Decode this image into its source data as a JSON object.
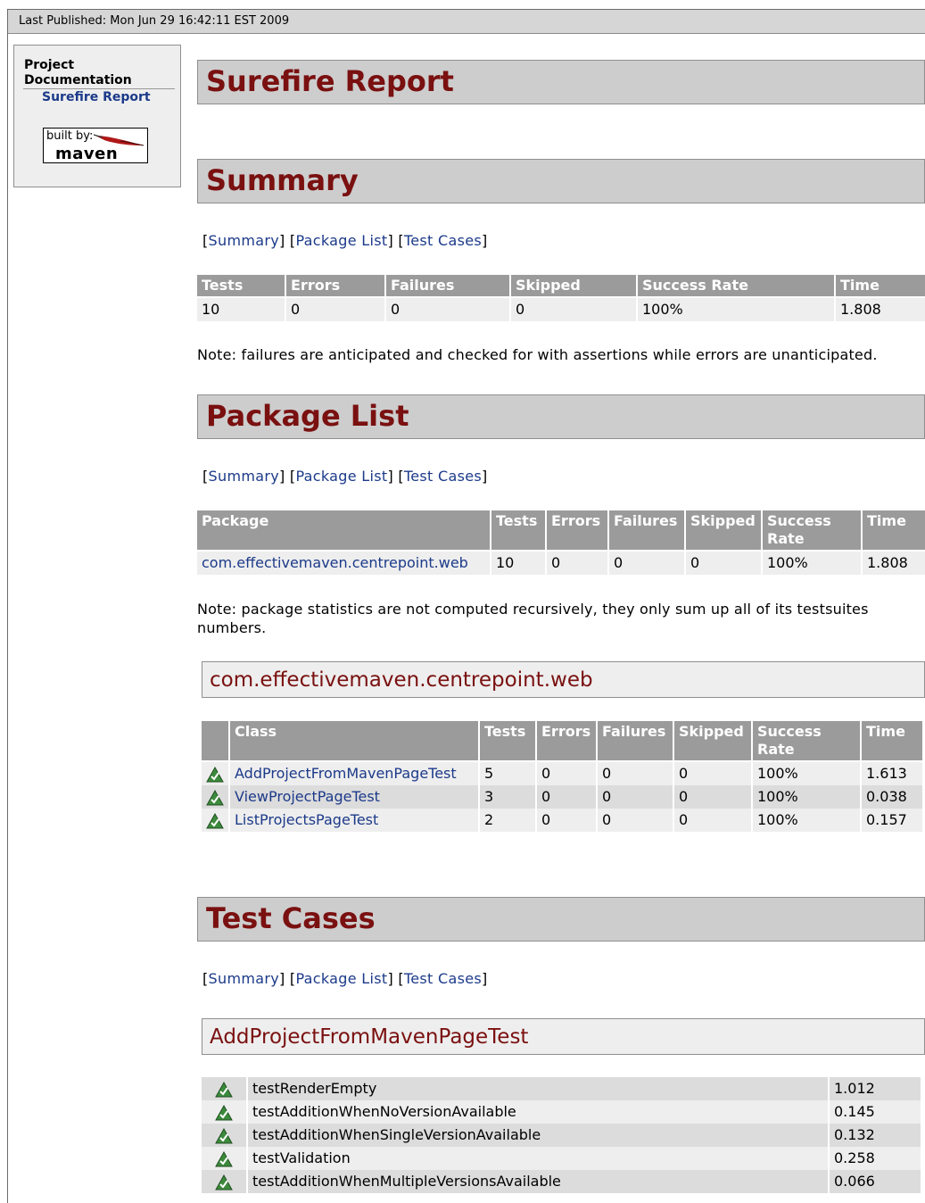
{
  "banner": {
    "published": "Last Published: Mon Jun 29 16:42:11 EST 2009"
  },
  "sidebar": {
    "heading_line1": "Project",
    "heading_line2": "Documentation",
    "link": "Surefire Report",
    "badge_built": "built by:",
    "badge_name": "maven"
  },
  "navlinks": {
    "summary": "Summary",
    "package_list": "Package List",
    "test_cases": "Test Cases"
  },
  "titles": {
    "report": "Surefire Report",
    "summary": "Summary",
    "package_list": "Package List",
    "test_cases": "Test Cases"
  },
  "summary_table": {
    "headers": [
      "Tests",
      "Errors",
      "Failures",
      "Skipped",
      "Success Rate",
      "Time"
    ],
    "row": [
      "10",
      "0",
      "0",
      "0",
      "100%",
      "1.808"
    ]
  },
  "summary_note": "Note: failures are anticipated and checked for with assertions while errors are unanticipated.",
  "package_table": {
    "headers": [
      "Package",
      "Tests",
      "Errors",
      "Failures",
      "Skipped",
      "Success Rate",
      "Time"
    ],
    "row": [
      "com.effectivemaven.centrepoint.web",
      "10",
      "0",
      "0",
      "0",
      "100%",
      "1.808"
    ]
  },
  "package_note": "Note: package statistics are not computed recursively, they only sum up all of its testsuites numbers.",
  "package_section": {
    "title": "com.effectivemaven.centrepoint.web",
    "headers": [
      "Class",
      "Tests",
      "Errors",
      "Failures",
      "Skipped",
      "Success Rate",
      "Time"
    ],
    "rows": [
      [
        "AddProjectFromMavenPageTest",
        "5",
        "0",
        "0",
        "0",
        "100%",
        "1.613"
      ],
      [
        "ViewProjectPageTest",
        "3",
        "0",
        "0",
        "0",
        "100%",
        "0.038"
      ],
      [
        "ListProjectsPageTest",
        "2",
        "0",
        "0",
        "0",
        "100%",
        "0.157"
      ]
    ]
  },
  "testcase_section": {
    "title": "AddProjectFromMavenPageTest",
    "rows": [
      [
        "testRenderEmpty",
        "1.012"
      ],
      [
        "testAdditionWhenNoVersionAvailable",
        "0.145"
      ],
      [
        "testAdditionWhenSingleVersionAvailable",
        "0.132"
      ],
      [
        "testValidation",
        "0.258"
      ],
      [
        "testAdditionWhenMultipleVersionsAvailable",
        "0.066"
      ]
    ]
  }
}
